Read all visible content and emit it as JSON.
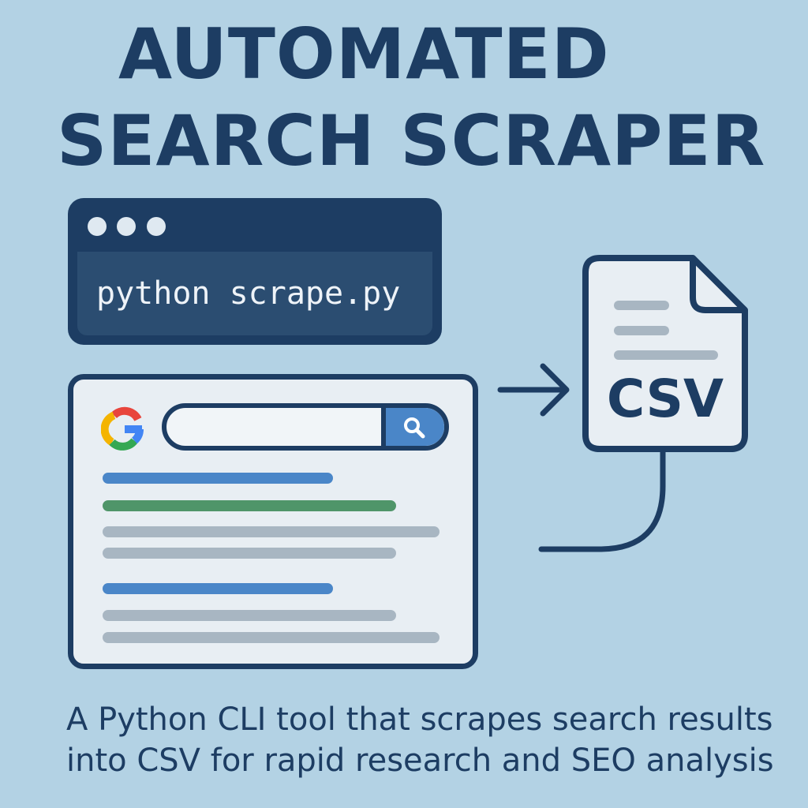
{
  "title": {
    "line1": "AUTOMATED",
    "line2": "SEARCH SCRAPER"
  },
  "terminal": {
    "command": "python scrape.py",
    "window_dots": 3
  },
  "browser": {
    "logo_icon": "google-g-icon",
    "search_button_icon": "magnifier-icon",
    "result_line_colors": [
      "#4a86c8",
      "#4f9569",
      "#a8b6c2"
    ]
  },
  "file": {
    "label": "CSV",
    "icon": "document-icon"
  },
  "description": "A Python CLI tool that scrapes search results into CSV for rapid research and SEO analysis",
  "colors": {
    "background": "#b3d2e4",
    "primary": "#1d3d63",
    "accent": "#4a86c8"
  }
}
